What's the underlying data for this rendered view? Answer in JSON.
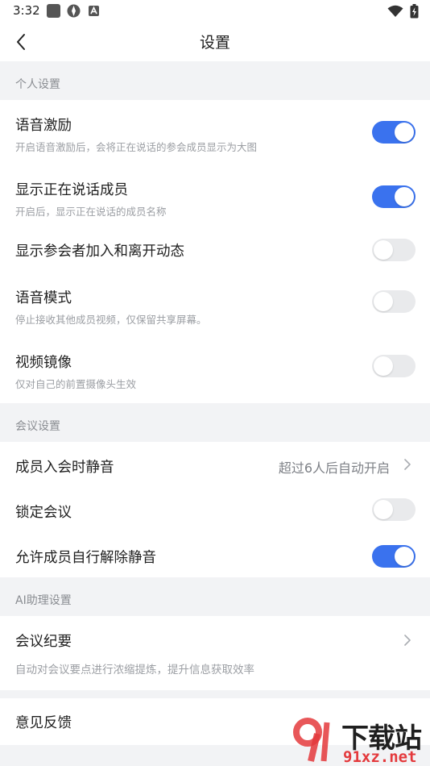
{
  "status": {
    "time": "3:32"
  },
  "header": {
    "title": "设置"
  },
  "sections": {
    "personal": "个人设置",
    "meeting": "会议设置",
    "ai": "AI助理设置"
  },
  "personal_items": [
    {
      "title": "语音激励",
      "subtitle": "开启语音激励后，会将正在说话的参会成员显示为大图",
      "toggle": true
    },
    {
      "title": "显示正在说话成员",
      "subtitle": "开启后，显示正在说话的成员名称",
      "toggle": true
    },
    {
      "title": "显示参会者加入和离开动态",
      "toggle": false
    },
    {
      "title": "语音模式",
      "subtitle": "停止接收其他成员视频，仅保留共享屏幕。",
      "toggle": false
    },
    {
      "title": "视频镜像",
      "subtitle": "仅对自己的前置摄像头生效",
      "toggle": false
    }
  ],
  "meeting_items": [
    {
      "title": "成员入会时静音",
      "value": "超过6人后自动开启"
    },
    {
      "title": "锁定会议",
      "toggle": false
    },
    {
      "title": "允许成员自行解除静音",
      "toggle": true
    }
  ],
  "ai_items": [
    {
      "title": "会议纪要",
      "subtitle": "自动对会议要点进行浓缩提炼，提升信息获取效率"
    }
  ],
  "feedback": {
    "title": "意见反馈"
  },
  "watermark": {
    "text_main": "下载站",
    "text_url": "91xz.net"
  },
  "colors": {
    "accent": "#3a72ee",
    "toggle_off": "#e9eaec",
    "background": "#f2f3f5"
  }
}
